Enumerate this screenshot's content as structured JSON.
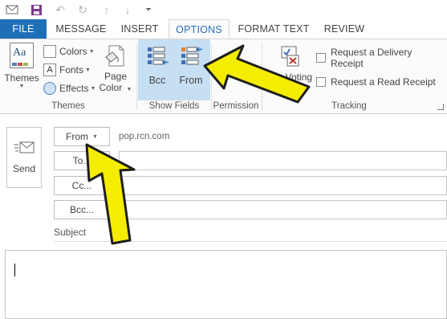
{
  "quick_access": {
    "icons": [
      "envelope-icon",
      "save-icon",
      "undo-icon",
      "redo-icon",
      "up-arrow-icon",
      "down-arrow-icon",
      "customize-dropdown-icon"
    ]
  },
  "tabs": [
    {
      "label": "FILE"
    },
    {
      "label": "MESSAGE"
    },
    {
      "label": "INSERT"
    },
    {
      "label": "OPTIONS"
    },
    {
      "label": "FORMAT TEXT"
    },
    {
      "label": "REVIEW"
    }
  ],
  "ribbon": {
    "themes_group": {
      "label": "Themes",
      "themes_button": "Themes",
      "colors_button": "Colors",
      "fonts_button": "Fonts",
      "effects_button": "Effects",
      "page_color_line1": "Page",
      "page_color_line2": "Color"
    },
    "show_fields_group": {
      "label": "Show Fields",
      "bcc_button": "Bcc",
      "from_button": "From"
    },
    "permission_group": {
      "label": "Permission"
    },
    "tracking_group": {
      "label": "Tracking",
      "use_voting_partial": "Use Voting",
      "delivery_receipt": "Request a Delivery Receipt",
      "read_receipt": "Request a Read Receipt"
    }
  },
  "compose": {
    "send_label": "Send",
    "from_button": "From",
    "sender_account": "pop.rcn.com",
    "to_button": "To...",
    "cc_button": "Cc...",
    "bcc_button": "Bcc...",
    "subject_label": "Subject"
  },
  "colors": {
    "file_tab": "#1f6fb8",
    "active_tab_text": "#2a6db7",
    "show_fields_highlight": "#c7dff3",
    "annotation_arrow": "#f5ed00"
  }
}
